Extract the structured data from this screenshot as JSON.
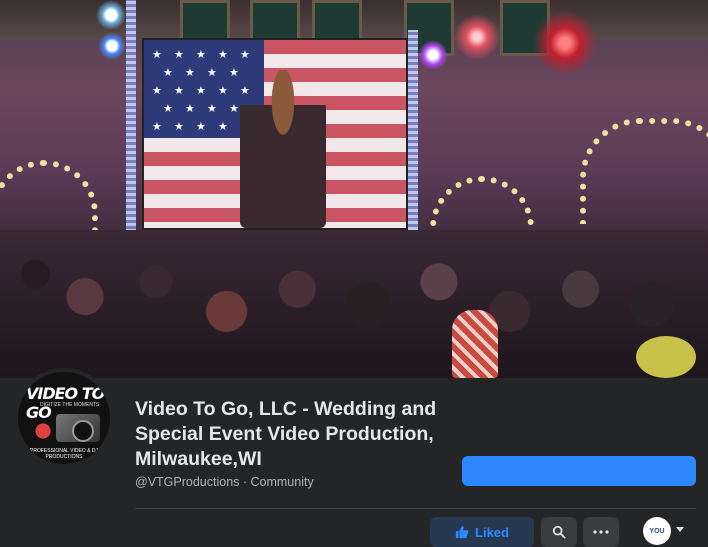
{
  "page": {
    "name": "Video To Go, LLC - Wedding and Special Event Video Production, Milwaukee,WI",
    "handle": "@VTGProductions · Community"
  },
  "logo": {
    "title": "VIDEO TO GO",
    "tagline": "DIGITIZE THE MOMENTS",
    "footer": "PROFESSIONAL VIDEO & DJ PRODUCTIONS"
  },
  "actions": {
    "liked_label": "Liked",
    "you_label": "YOU"
  },
  "icons": {
    "liked": "thumbs-up-icon",
    "search": "search-icon",
    "more": "more-icon",
    "dropdown": "chevron-down-icon"
  },
  "colors": {
    "background": "#242526",
    "primary_button": "#2d88ff",
    "liked_bg": "#263951",
    "text": "#e4e6eb",
    "subtext": "#b0b3b8"
  }
}
